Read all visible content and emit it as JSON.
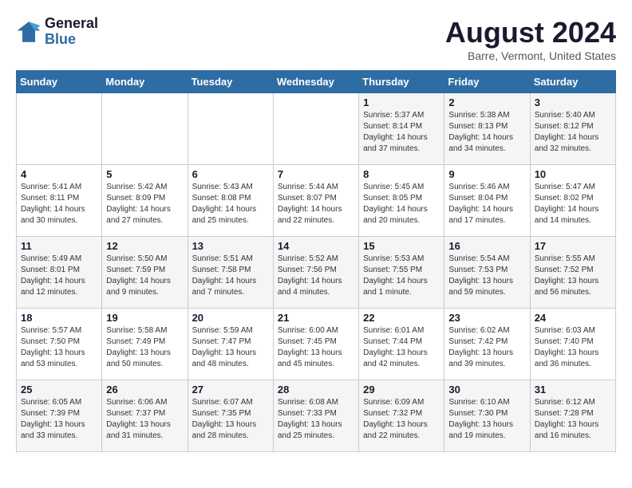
{
  "logo": {
    "line1": "General",
    "line2": "Blue"
  },
  "title": "August 2024",
  "subtitle": "Barre, Vermont, United States",
  "weekdays": [
    "Sunday",
    "Monday",
    "Tuesday",
    "Wednesday",
    "Thursday",
    "Friday",
    "Saturday"
  ],
  "weeks": [
    [
      {
        "day": "",
        "content": ""
      },
      {
        "day": "",
        "content": ""
      },
      {
        "day": "",
        "content": ""
      },
      {
        "day": "",
        "content": ""
      },
      {
        "day": "1",
        "content": "Sunrise: 5:37 AM\nSunset: 8:14 PM\nDaylight: 14 hours\nand 37 minutes."
      },
      {
        "day": "2",
        "content": "Sunrise: 5:38 AM\nSunset: 8:13 PM\nDaylight: 14 hours\nand 34 minutes."
      },
      {
        "day": "3",
        "content": "Sunrise: 5:40 AM\nSunset: 8:12 PM\nDaylight: 14 hours\nand 32 minutes."
      }
    ],
    [
      {
        "day": "4",
        "content": "Sunrise: 5:41 AM\nSunset: 8:11 PM\nDaylight: 14 hours\nand 30 minutes."
      },
      {
        "day": "5",
        "content": "Sunrise: 5:42 AM\nSunset: 8:09 PM\nDaylight: 14 hours\nand 27 minutes."
      },
      {
        "day": "6",
        "content": "Sunrise: 5:43 AM\nSunset: 8:08 PM\nDaylight: 14 hours\nand 25 minutes."
      },
      {
        "day": "7",
        "content": "Sunrise: 5:44 AM\nSunset: 8:07 PM\nDaylight: 14 hours\nand 22 minutes."
      },
      {
        "day": "8",
        "content": "Sunrise: 5:45 AM\nSunset: 8:05 PM\nDaylight: 14 hours\nand 20 minutes."
      },
      {
        "day": "9",
        "content": "Sunrise: 5:46 AM\nSunset: 8:04 PM\nDaylight: 14 hours\nand 17 minutes."
      },
      {
        "day": "10",
        "content": "Sunrise: 5:47 AM\nSunset: 8:02 PM\nDaylight: 14 hours\nand 14 minutes."
      }
    ],
    [
      {
        "day": "11",
        "content": "Sunrise: 5:49 AM\nSunset: 8:01 PM\nDaylight: 14 hours\nand 12 minutes."
      },
      {
        "day": "12",
        "content": "Sunrise: 5:50 AM\nSunset: 7:59 PM\nDaylight: 14 hours\nand 9 minutes."
      },
      {
        "day": "13",
        "content": "Sunrise: 5:51 AM\nSunset: 7:58 PM\nDaylight: 14 hours\nand 7 minutes."
      },
      {
        "day": "14",
        "content": "Sunrise: 5:52 AM\nSunset: 7:56 PM\nDaylight: 14 hours\nand 4 minutes."
      },
      {
        "day": "15",
        "content": "Sunrise: 5:53 AM\nSunset: 7:55 PM\nDaylight: 14 hours\nand 1 minute."
      },
      {
        "day": "16",
        "content": "Sunrise: 5:54 AM\nSunset: 7:53 PM\nDaylight: 13 hours\nand 59 minutes."
      },
      {
        "day": "17",
        "content": "Sunrise: 5:55 AM\nSunset: 7:52 PM\nDaylight: 13 hours\nand 56 minutes."
      }
    ],
    [
      {
        "day": "18",
        "content": "Sunrise: 5:57 AM\nSunset: 7:50 PM\nDaylight: 13 hours\nand 53 minutes."
      },
      {
        "day": "19",
        "content": "Sunrise: 5:58 AM\nSunset: 7:49 PM\nDaylight: 13 hours\nand 50 minutes."
      },
      {
        "day": "20",
        "content": "Sunrise: 5:59 AM\nSunset: 7:47 PM\nDaylight: 13 hours\nand 48 minutes."
      },
      {
        "day": "21",
        "content": "Sunrise: 6:00 AM\nSunset: 7:45 PM\nDaylight: 13 hours\nand 45 minutes."
      },
      {
        "day": "22",
        "content": "Sunrise: 6:01 AM\nSunset: 7:44 PM\nDaylight: 13 hours\nand 42 minutes."
      },
      {
        "day": "23",
        "content": "Sunrise: 6:02 AM\nSunset: 7:42 PM\nDaylight: 13 hours\nand 39 minutes."
      },
      {
        "day": "24",
        "content": "Sunrise: 6:03 AM\nSunset: 7:40 PM\nDaylight: 13 hours\nand 36 minutes."
      }
    ],
    [
      {
        "day": "25",
        "content": "Sunrise: 6:05 AM\nSunset: 7:39 PM\nDaylight: 13 hours\nand 33 minutes."
      },
      {
        "day": "26",
        "content": "Sunrise: 6:06 AM\nSunset: 7:37 PM\nDaylight: 13 hours\nand 31 minutes."
      },
      {
        "day": "27",
        "content": "Sunrise: 6:07 AM\nSunset: 7:35 PM\nDaylight: 13 hours\nand 28 minutes."
      },
      {
        "day": "28",
        "content": "Sunrise: 6:08 AM\nSunset: 7:33 PM\nDaylight: 13 hours\nand 25 minutes."
      },
      {
        "day": "29",
        "content": "Sunrise: 6:09 AM\nSunset: 7:32 PM\nDaylight: 13 hours\nand 22 minutes."
      },
      {
        "day": "30",
        "content": "Sunrise: 6:10 AM\nSunset: 7:30 PM\nDaylight: 13 hours\nand 19 minutes."
      },
      {
        "day": "31",
        "content": "Sunrise: 6:12 AM\nSunset: 7:28 PM\nDaylight: 13 hours\nand 16 minutes."
      }
    ]
  ]
}
